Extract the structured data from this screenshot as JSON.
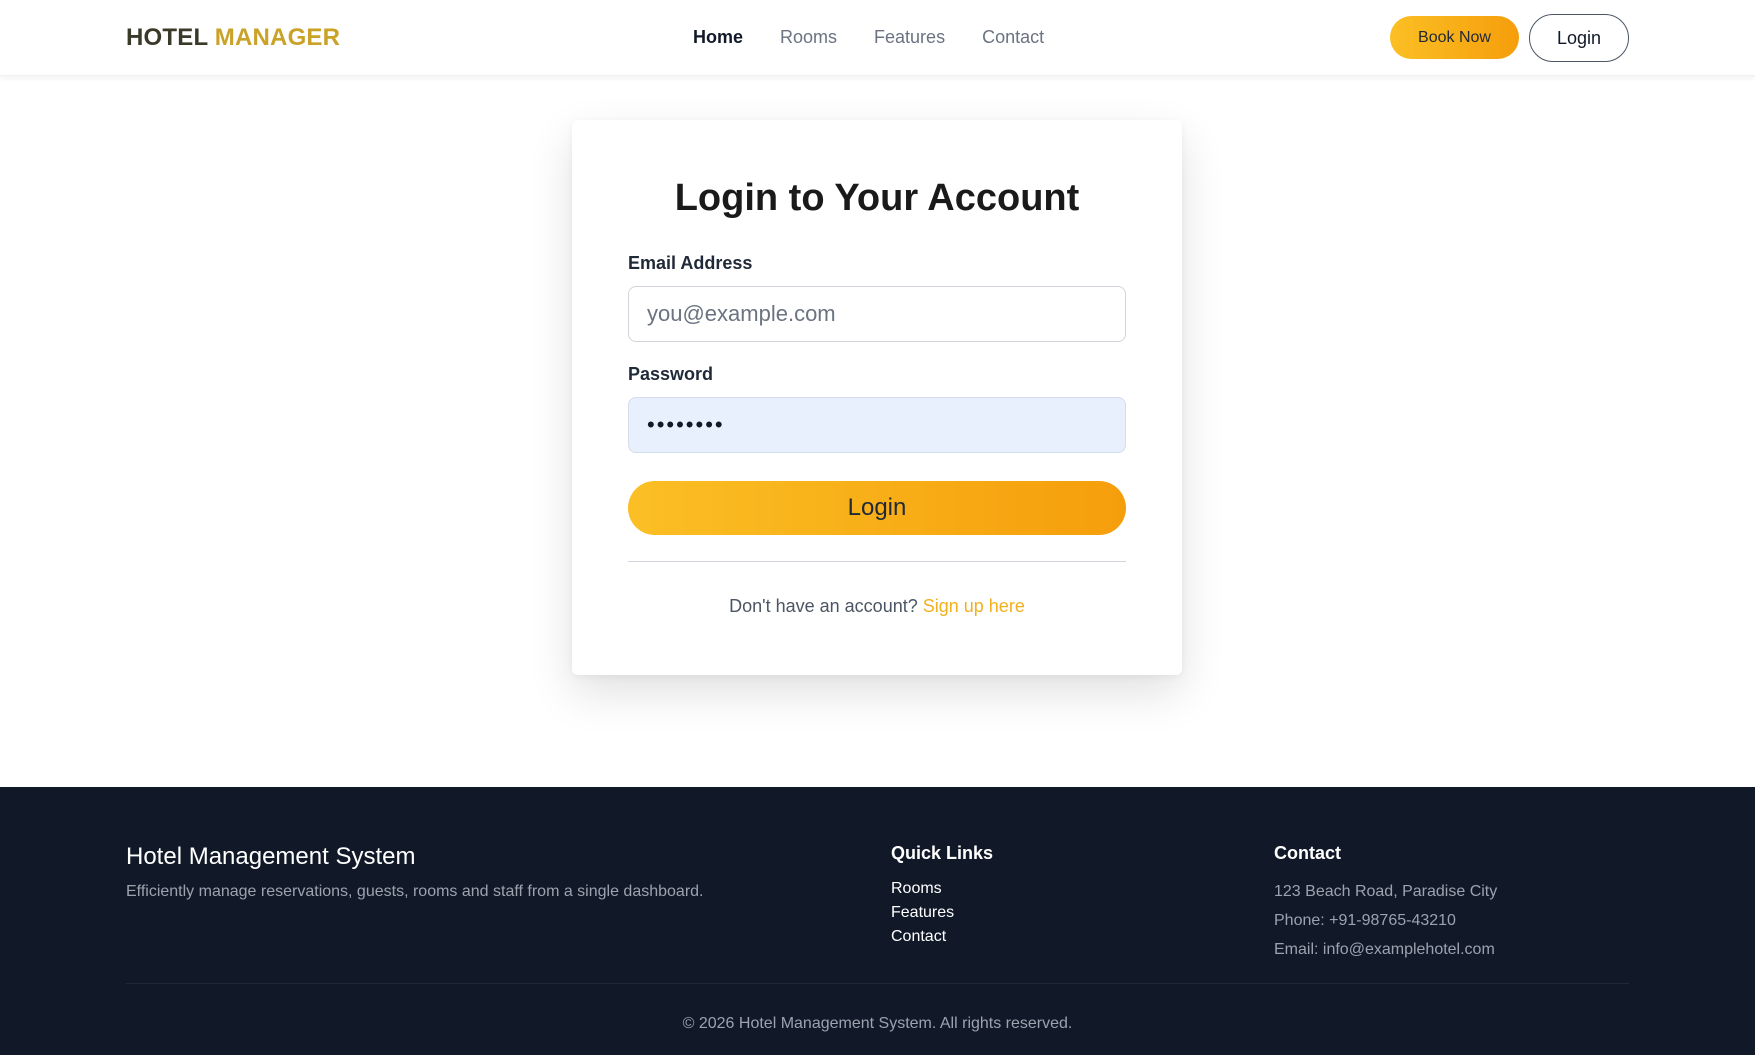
{
  "header": {
    "brand_part1": "HOTEL",
    "brand_part2": "MANAGER",
    "nav": [
      "Home",
      "Rooms",
      "Features",
      "Contact"
    ],
    "book_now": "Book Now",
    "login": "Login"
  },
  "login_card": {
    "title": "Login to Your Account",
    "email_label": "Email Address",
    "email_placeholder": "you@example.com",
    "email_value": "",
    "password_label": "Password",
    "password_value": "••••••••",
    "submit": "Login",
    "signup_prompt": "Don't have an account?",
    "signup_link": "Sign up here"
  },
  "footer": {
    "brand": "Hotel Management System",
    "description": "Efficiently manage reservations, guests, rooms and staff from a single dashboard.",
    "quick_links_title": "Quick Links",
    "quick_links": [
      "Rooms",
      "Features",
      "Contact"
    ],
    "contact_title": "Contact",
    "address": "123 Beach Road, Paradise City",
    "phone": "Phone: +91-98765-43210",
    "email": "Email: info@examplehotel.com",
    "copyright": "© 2026 Hotel Management System. All rights reserved."
  },
  "colors": {
    "accent": "#f59e0b",
    "accent_light": "#fbbf24",
    "footer_bg": "#111827",
    "link": "#f2b01e"
  }
}
